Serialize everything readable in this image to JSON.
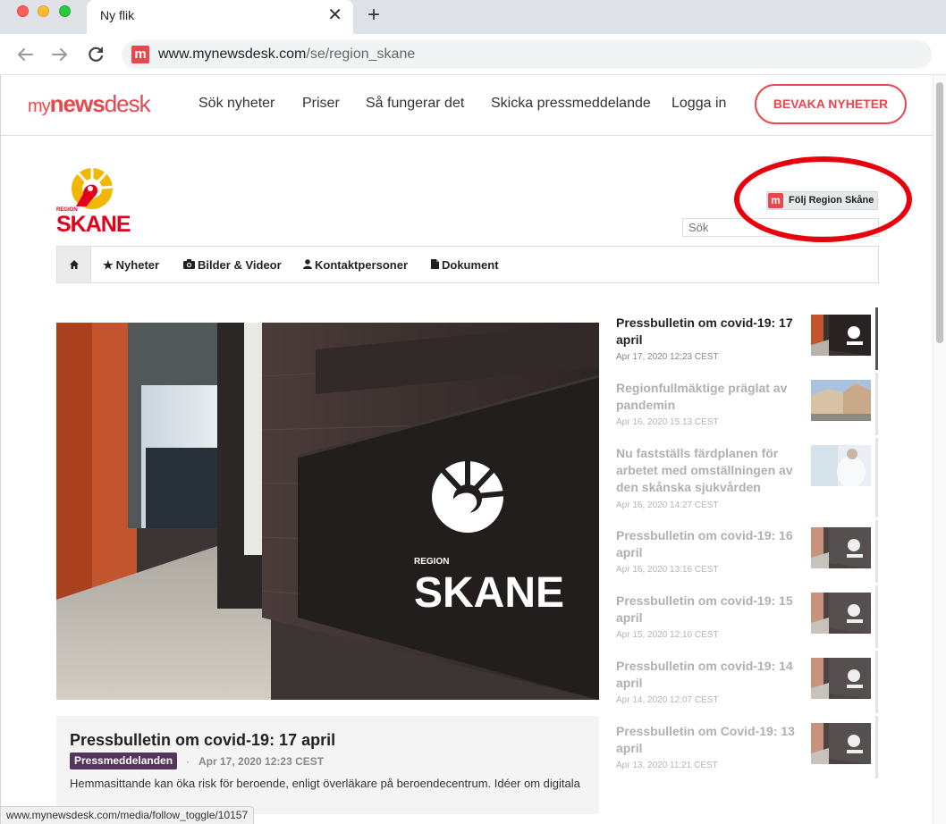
{
  "browser": {
    "tab_title": "Ny flik",
    "new_tab_symbol": "+",
    "url_host": "www.mynewsdesk.com",
    "url_path": "/se/region_skane",
    "favicon_letter": "m",
    "status_url": "www.mynewsdesk.com/media/follow_toggle/10157"
  },
  "site": {
    "brand": {
      "part1": "my",
      "part2": "news",
      "part3": "desk"
    },
    "nav": [
      "Sök nyheter",
      "Priser",
      "Så fungerar det",
      "Skicka pressmeddelande",
      "Logga in"
    ],
    "cta": "BEVAKA NYHETER"
  },
  "newsroom": {
    "logo_region": "REGION",
    "logo_name": "SKANE",
    "follow_letter": "m",
    "follow_label": "Följ Region Skåne",
    "search_placeholder": "Sök",
    "subnav": [
      {
        "label": "Nyheter",
        "icon": "star-icon"
      },
      {
        "label": "Bilder & Videor",
        "icon": "camera-icon"
      },
      {
        "label": "Kontaktpersoner",
        "icon": "user-icon"
      },
      {
        "label": "Dokument",
        "icon": "document-icon"
      }
    ],
    "hero_sign_region": "REGION",
    "hero_sign_name": "SKANE"
  },
  "featured": {
    "title": "Pressbulletin om covid-19: 17 april",
    "tag": "Pressmeddelanden",
    "separator": "·",
    "date": "Apr 17, 2020 12:23 CEST",
    "excerpt": "Hemmasittande kan öka risk för beroende, enligt överläkare på beroendecentrum. Idéer om digitala"
  },
  "news": [
    {
      "title": "Pressbulletin om covid-19: 17 april",
      "date": "Apr 17, 2020 12:23 CEST",
      "active": true
    },
    {
      "title": "Regionfullmäktige präglat av pandemin",
      "date": "Apr 16, 2020 15:13 CEST",
      "active": false
    },
    {
      "title": "Nu fastställs färdplanen för arbetet med omställningen av den skånska sjukvården",
      "date": "Apr 16, 2020 14:27 CEST",
      "active": false
    },
    {
      "title": "Pressbulletin om covid-19: 16 april",
      "date": "Apr 16, 2020 13:16 CEST",
      "active": false
    },
    {
      "title": "Pressbulletin om covid-19: 15 april",
      "date": "Apr 15, 2020 12:10 CEST",
      "active": false
    },
    {
      "title": "Pressbulletin om covid-19: 14 april",
      "date": "Apr 14, 2020 12:07 CEST",
      "active": false
    },
    {
      "title": "Pressbulletin om Covid-19: 13 april",
      "date": "Apr 13, 2020 11:21 CEST",
      "active": false
    }
  ],
  "colors": {
    "brand_red": "#e8474c",
    "region_red": "#e2001a",
    "region_yellow": "#f2b705",
    "tag_purple": "#55355d",
    "annotation_red": "#e8000d"
  }
}
